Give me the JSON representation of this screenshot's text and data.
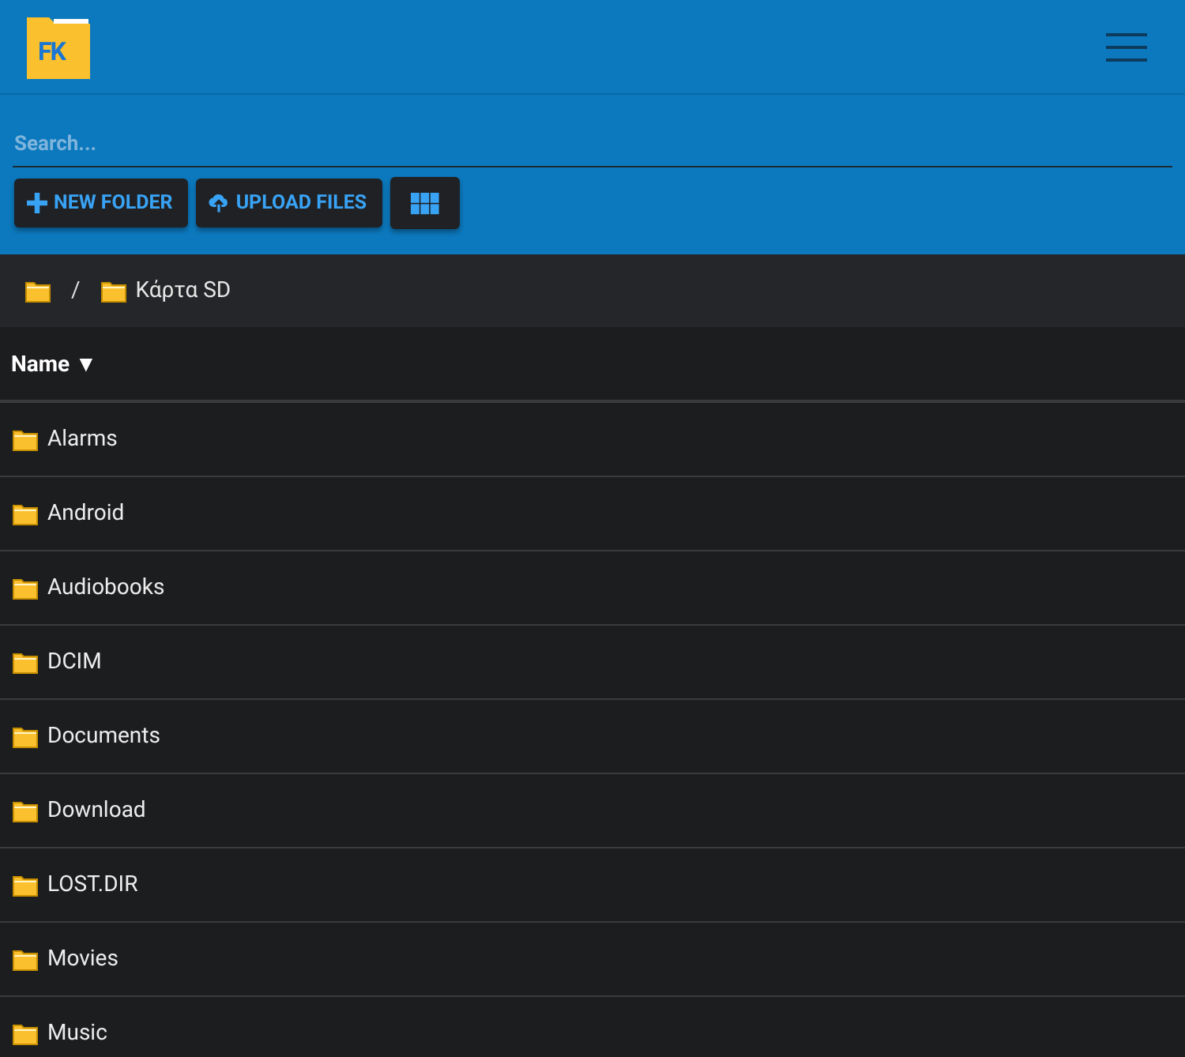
{
  "header": {
    "logo_text": "FK"
  },
  "search": {
    "placeholder": "Search..."
  },
  "toolbar": [
    {
      "kind": "new-folder",
      "label": "NEW FOLDER"
    },
    {
      "kind": "upload",
      "label": "UPLOAD FILES"
    },
    {
      "kind": "grid"
    }
  ],
  "breadcrumb": {
    "separator": "/",
    "items": [
      {
        "kind": "root"
      },
      {
        "kind": "folder",
        "label": "Κάρτα SD"
      }
    ]
  },
  "table": {
    "columns": [
      {
        "label": "Name",
        "sort_indicator": "▼"
      }
    ],
    "rows": [
      {
        "name": "Alarms"
      },
      {
        "name": "Android"
      },
      {
        "name": "Audiobooks"
      },
      {
        "name": "DCIM"
      },
      {
        "name": "Documents"
      },
      {
        "name": "Download"
      },
      {
        "name": "LOST.DIR"
      },
      {
        "name": "Movies"
      },
      {
        "name": "Music"
      }
    ]
  }
}
